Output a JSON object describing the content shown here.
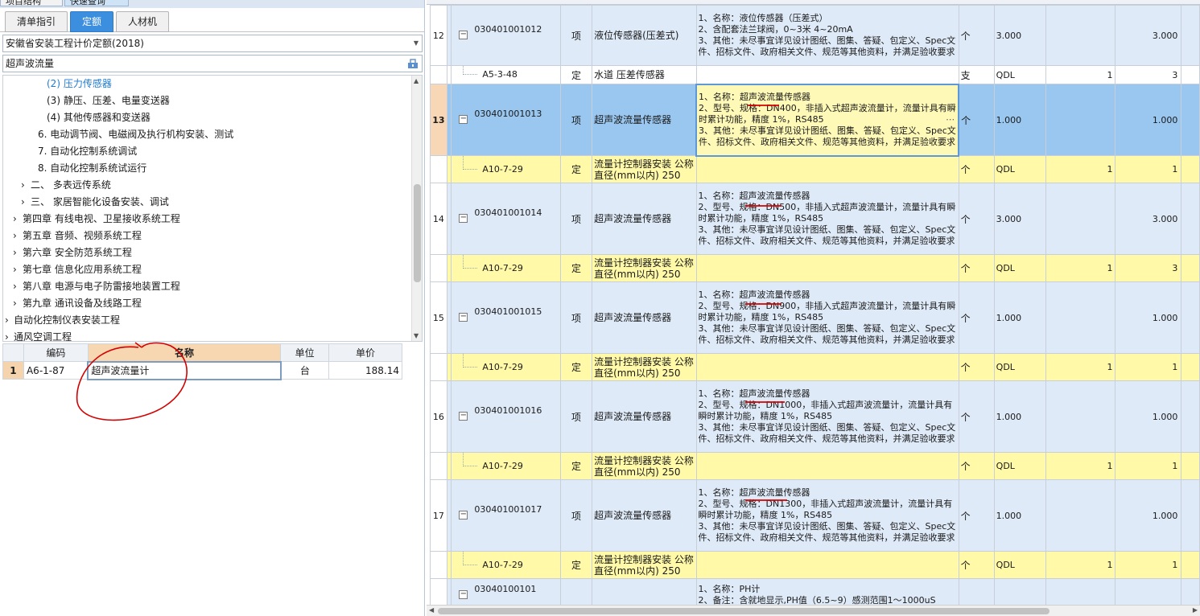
{
  "left": {
    "top_tabs": [
      "项目结构",
      "快速查询"
    ],
    "tabs": [
      "清单指引",
      "定额",
      "人材机"
    ],
    "active_tab": "定额",
    "quota_library": "安徽省安装工程计价定额(2018)",
    "search_value": "超声波流量",
    "tree": [
      {
        "label": "(2) 压力传感器",
        "selected": true
      },
      {
        "label": "(3) 静压、压差、电量变送器"
      },
      {
        "label": "(4) 其他传感器和变送器"
      },
      {
        "label": "6. 电动调节阀、电磁阀及执行机构安装、测试"
      },
      {
        "label": "7. 自动化控制系统调试"
      },
      {
        "label": "8. 自动化控制系统试运行"
      },
      {
        "label": "二、  多表远传系统"
      },
      {
        "label": "三、  家居智能化设备安装、调试"
      },
      {
        "label": "第四章 有线电视、卫星接收系统工程"
      },
      {
        "label": "第五章 音频、视频系统工程"
      },
      {
        "label": "第六章 安全防范系统工程"
      },
      {
        "label": "第七章 信息化应用系统工程"
      },
      {
        "label": "第八章 电源与电子防雷接地装置工程"
      },
      {
        "label": "第九章 通讯设备及线路工程"
      },
      {
        "label": "自动化控制仪表安装工程"
      },
      {
        "label": "通风空调工程"
      }
    ],
    "result_headers": [
      "编码",
      "名称",
      "单位",
      "单价"
    ],
    "results": [
      {
        "no": "1",
        "code": "A6-1-87",
        "name": "超声波流量计",
        "unit": "台",
        "price": "188.14"
      }
    ]
  },
  "right": {
    "rows": [
      {
        "type": "item",
        "no": "12",
        "code": "030401001012",
        "cat": "项",
        "name": "液位传感器(压差式)",
        "desc": [
          "1、名称：液位传感器（压差式）",
          "2、含配套法兰球阀，0~3米 4~20mA",
          "3、其他：未尽事宜详见设计图纸、图集、答疑、包定义、Spec文件、招标文件、政府相关文件、规范等其他资料，并满足验收要求"
        ],
        "unit": "个",
        "qd": "3.000",
        "q1": "",
        "q2": "3.000"
      },
      {
        "type": "quota",
        "plain": true,
        "code": "A5-3-48",
        "cat": "定",
        "name": "水道 压差传感器",
        "desc": [],
        "unit": "支",
        "qd": "QDL",
        "q1": "1",
        "q2": "3"
      },
      {
        "type": "item",
        "selected": true,
        "no": "13",
        "code": "030401001013",
        "cat": "项",
        "name": "超声波流量传感器",
        "desc": [
          "1、名称：超声波流量传感器",
          "2、型号、规格：DN400，非插入式超声波流量计，流量计具有瞬时累计功能，精度 1%，RS485",
          "3、其他：未尽事宜详见设计图纸、图集、答疑、包定义、Spec文件、招标文件、政府相关文件、规范等其他资料，并满足验收要求"
        ],
        "unit": "个",
        "qd": "1.000",
        "q1": "",
        "q2": "1.000",
        "ellipsis": "⋯"
      },
      {
        "type": "quota",
        "code": "A10-7-29",
        "cat": "定",
        "name": "流量计控制器安装 公称直径(mm以内) 250",
        "desc": [],
        "unit": "个",
        "qd": "QDL",
        "q1": "1",
        "q2": "1"
      },
      {
        "type": "item",
        "no": "14",
        "code": "030401001014",
        "cat": "项",
        "name": "超声波流量传感器",
        "desc": [
          "1、名称：超声波流量传感器",
          "2、型号、规格：DN500，非插入式超声波流量计，流量计具有瞬时累计功能，精度 1%，RS485",
          "3、其他：未尽事宜详见设计图纸、图集、答疑、包定义、Spec文件、招标文件、政府相关文件、规范等其他资料，并满足验收要求"
        ],
        "unit": "个",
        "qd": "3.000",
        "q1": "",
        "q2": "3.000"
      },
      {
        "type": "quota",
        "code": "A10-7-29",
        "cat": "定",
        "name": "流量计控制器安装 公称直径(mm以内) 250",
        "desc": [],
        "unit": "个",
        "qd": "QDL",
        "q1": "1",
        "q2": "3"
      },
      {
        "type": "item",
        "no": "15",
        "code": "030401001015",
        "cat": "项",
        "name": "超声波流量传感器",
        "desc": [
          "1、名称：超声波流量传感器",
          "2、型号、规格：DN900，非插入式超声波流量计，流量计具有瞬时累计功能，精度 1%，RS485",
          "3、其他：未尽事宜详见设计图纸、图集、答疑、包定义、Spec文件、招标文件、政府相关文件、规范等其他资料，并满足验收要求"
        ],
        "unit": "个",
        "qd": "1.000",
        "q1": "",
        "q2": "1.000"
      },
      {
        "type": "quota",
        "code": "A10-7-29",
        "cat": "定",
        "name": "流量计控制器安装 公称直径(mm以内) 250",
        "desc": [],
        "unit": "个",
        "qd": "QDL",
        "q1": "1",
        "q2": "1"
      },
      {
        "type": "item",
        "no": "16",
        "code": "030401001016",
        "cat": "项",
        "name": "超声波流量传感器",
        "desc": [
          "1、名称：超声波流量传感器",
          "2、型号、规格：DN1000，非插入式超声波流量计，流量计具有瞬时累计功能，精度 1%，RS485",
          "3、其他：未尽事宜详见设计图纸、图集、答疑、包定义、Spec文件、招标文件、政府相关文件、规范等其他资料，并满足验收要求"
        ],
        "unit": "个",
        "qd": "1.000",
        "q1": "",
        "q2": "1.000"
      },
      {
        "type": "quota",
        "code": "A10-7-29",
        "cat": "定",
        "name": "流量计控制器安装 公称直径(mm以内) 250",
        "desc": [],
        "unit": "个",
        "qd": "QDL",
        "q1": "1",
        "q2": "1"
      },
      {
        "type": "item",
        "no": "17",
        "code": "030401001017",
        "cat": "项",
        "name": "超声波流量传感器",
        "desc": [
          "1、名称：超声波流量传感器",
          "2、型号、规格：DN1300，非插入式超声波流量计，流量计具有瞬时累计功能，精度 1%，RS485",
          "3、其他：未尽事宜详见设计图纸、图集、答疑、包定义、Spec文件、招标文件、政府相关文件、规范等其他资料，并满足验收要求"
        ],
        "unit": "个",
        "qd": "1.000",
        "q1": "",
        "q2": "1.000"
      },
      {
        "type": "quota",
        "code": "A10-7-29",
        "cat": "定",
        "name": "流量计控制器安装 公称直径(mm以内) 250",
        "desc": [],
        "unit": "个",
        "qd": "QDL",
        "q1": "1",
        "q2": "1"
      },
      {
        "type": "item",
        "no": "",
        "code": "03040100101",
        "cat": "",
        "name": "",
        "desc": [
          "1、名称：PH计",
          "2、备注：含就地显示,PH值（6.5~9）感测范围1～1000uS"
        ],
        "unit": "",
        "qd": "",
        "q1": "",
        "q2": ""
      }
    ]
  },
  "colors": {
    "accent": "#3c8fdf",
    "selected_row": "#9ac7f0",
    "quota_row": "#fff9a8",
    "item_row": "#dfeaf8",
    "annotation": "#d40000"
  },
  "icons": {
    "search": "search-icon",
    "collapse": "minus-icon",
    "dropdown": "chevron-down-icon"
  }
}
